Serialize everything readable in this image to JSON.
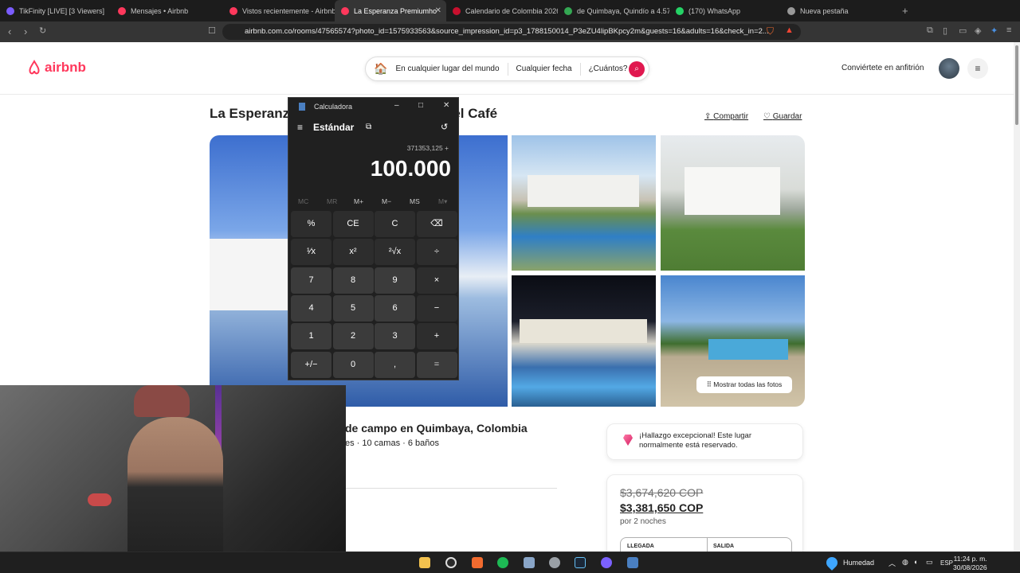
{
  "browser": {
    "tabs": [
      {
        "label": "TikFinity [LIVE] [3 Viewers]",
        "color": "#7a5cff"
      },
      {
        "label": "Mensajes • Airbnb",
        "color": "#ff385c"
      },
      {
        "label": "Vistos recientemente - Airbnb",
        "color": "#ff385c"
      },
      {
        "label": "La Esperanza Premiumho",
        "color": "#ff385c",
        "active": true
      },
      {
        "label": "Calendario de Colombia 2026",
        "color": "#c8102e"
      },
      {
        "label": "de Quimbaya, Quindío a 4.57€",
        "color": "#34a853"
      },
      {
        "label": "(170) WhatsApp",
        "color": "#25d366"
      },
      {
        "label": "Nueva pestaña",
        "color": "#999999"
      }
    ],
    "url": "airbnb.com.co/rooms/47565574?photo_id=1575933563&source_impression_id=p3_1788150014_P3eZU4lipBKpcy2m&guests=16&adults=16&check_in=2..."
  },
  "airbnb": {
    "logo": "airbnb",
    "search": {
      "where": "En cualquier lugar del mundo",
      "when": "Cualquier fecha",
      "who": "¿Cuántos?"
    },
    "host_link": "Conviértete en anfitrión",
    "title_left": "La Esperanza",
    "title_right": "Parque del Café",
    "share": "Compartir",
    "save": "Guardar",
    "show_all_photos": "Mostrar todas las fotos",
    "subtitle": "de campo en Quimbaya, Colombia",
    "details": "es · 10 camas · 6 baños",
    "rare_find": "¡Hallazgo excepcional! Este lugar normalmente está reservado.",
    "price_old": "$3,674,620 COP",
    "price_new": "$3,381,650 COP",
    "nights": "por 2 noches",
    "checkin_label": "LLEGADA",
    "checkout_label": "SALIDA"
  },
  "calculator": {
    "window_title": "Calculadora",
    "mode": "Estándar",
    "expression": "371353,125 +",
    "display": "100.000",
    "memory": [
      "MC",
      "MR",
      "M+",
      "M−",
      "MS",
      "M▾"
    ],
    "keys": [
      [
        "%",
        "CE",
        "C",
        "⌫"
      ],
      [
        "¹⁄x",
        "x²",
        "²√x",
        "÷"
      ],
      [
        "7",
        "8",
        "9",
        "×"
      ],
      [
        "4",
        "5",
        "6",
        "−"
      ],
      [
        "1",
        "2",
        "3",
        "+"
      ],
      [
        "+/−",
        "0",
        ",",
        "="
      ]
    ]
  },
  "taskbar": {
    "weather": "Humedad",
    "lang": "ESP",
    "time": "11:24 p. m.",
    "date": "30/08/2026"
  },
  "colors": {
    "brand": "#ff385c",
    "search_button": "#e0184f"
  }
}
